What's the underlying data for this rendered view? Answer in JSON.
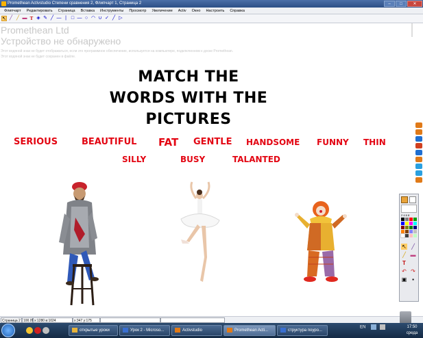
{
  "titlebar": {
    "title": "Promethean Activstudio   Степени сравнения 2, Флипчарт 1, Страница 2",
    "minimize": "–",
    "maximize": "□",
    "close": "✕"
  },
  "menubar": {
    "items": [
      "Флипчарт",
      "Редактировать",
      "Страница",
      "Вставка",
      "Инструменты",
      "Просмотр",
      "Увеличение",
      "Activ",
      "Окно",
      "Настроить",
      "Справка"
    ]
  },
  "toolbar": {
    "glyphs": {
      "pointer": "↖",
      "pen": "╱",
      "highlighter": "╱",
      "eraser": "▬",
      "text": "T",
      "fill": "◈",
      "marker": "✎",
      "line": "╱",
      "dash": "—",
      "bar": "|",
      "rect": "□",
      "dash2": "—",
      "ellipse": "○",
      "arc": "◠",
      "curve": "∪",
      "check": "✓",
      "slash": "╱",
      "arrow": "▷"
    }
  },
  "watermark": {
    "line1": "Promethean Ltd",
    "line2": "Устройство не обнаружено",
    "line3": "Этот водяной знак не будет отображаться, если это программное обеспечение, используется на компьютере, подключенном к доске Promethean.",
    "line4": "Этот водяной знак не будет сохранен в файле."
  },
  "heading": {
    "line1": "MATCH THE",
    "line2": "WORDS WITH THE",
    "line3": "PICTURES"
  },
  "words": {
    "serious": "SERIOUS",
    "beautiful": "BEAUTIFUL",
    "fat": "FAT",
    "gentle": "GENTLE",
    "handsome": "HANDSOME",
    "funny": "FUNNY",
    "thin": "THIN",
    "silly": "SILLY",
    "busy": "BUSY",
    "talanted": "TALANTED"
  },
  "palette": {
    "width_labels": "2 4 6 8",
    "top_colors": [
      "#e8a33a",
      "#ffffff"
    ],
    "colors": [
      [
        "#000000",
        "#7f7f7f",
        "#ff0000",
        "#00a000"
      ],
      [
        "#0000ff",
        "#ffff00",
        "#ff00ff",
        "#00ffff"
      ],
      [
        "#800000",
        "#808000",
        "#008000",
        "#000080"
      ],
      [
        "#ff8000",
        "#804000",
        "#8080ff",
        "#c0c0c0"
      ],
      [
        "#ffffff",
        "#404040",
        "#ffc0c0",
        "#c0ffc0"
      ]
    ],
    "tool_glyphs": [
      "↖",
      "╱",
      "╱",
      "▬",
      "T",
      "↶",
      "↷",
      "▣",
      "▪"
    ]
  },
  "right_strip": {
    "colors": [
      "#e07a18",
      "#e07a18",
      "#1f6fd1",
      "#d04020",
      "#1f6fd1",
      "#e07a18",
      "#2aa0e0",
      "#2aa0e0",
      "#e07a18"
    ]
  },
  "statusbar": {
    "page": "Страница 2",
    "zoom": "100.0%",
    "resolution": "x:1280 в:1024",
    "coords": "x:347 y:175"
  },
  "taskbar": {
    "tasks": [
      {
        "label": "открытые уроки",
        "icon_color": "#e6b33a"
      },
      {
        "label": "Урок 2 - Microso...",
        "icon_color": "#3a6fd0"
      },
      {
        "label": "Activstudio",
        "icon_color": "#e07a18"
      },
      {
        "label": "Promethean Acti...",
        "icon_color": "#e07a18"
      },
      {
        "label": "структура поуро...",
        "icon_color": "#3a6fd0"
      }
    ],
    "lang": "EN",
    "time": "17:50",
    "day": "среда"
  },
  "colors": {
    "word_red": "#e30613",
    "heading": "#000000"
  }
}
